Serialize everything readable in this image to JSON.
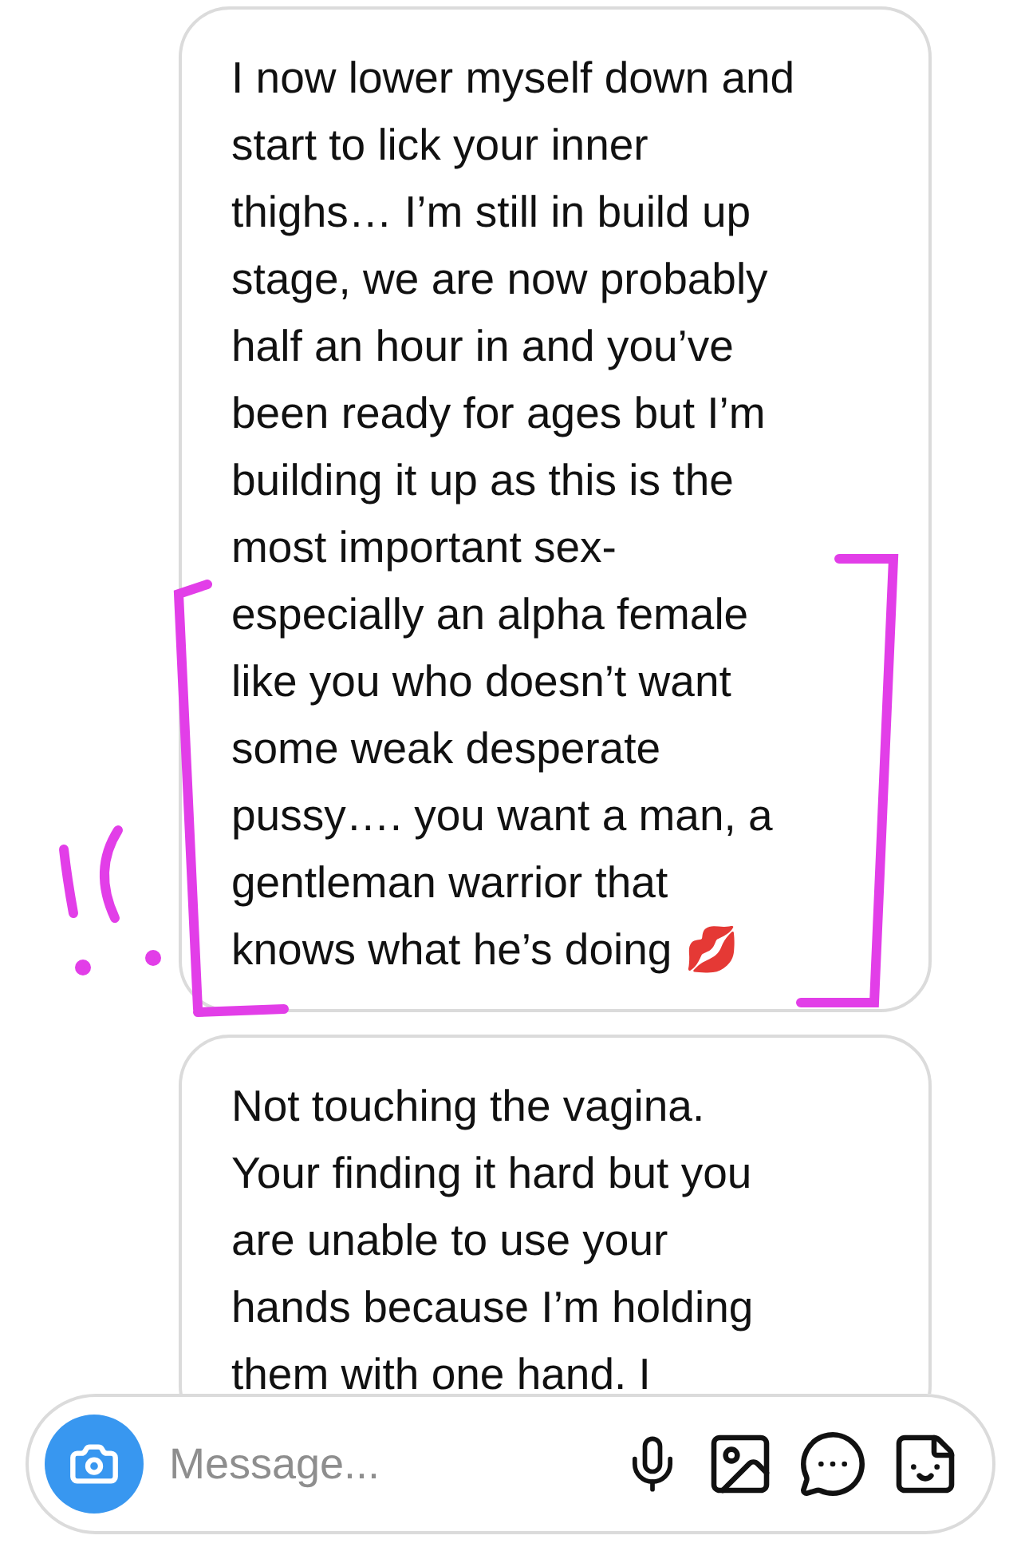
{
  "messages": [
    {
      "text": "I now lower myself down and start to lick your inner thighs… I’m still in build up stage, we are now probably half an hour in and you’ve been ready for ages but I’m building it up as this is the most important sex- especially an alpha female like you who doesn’t want some weak desperate pussy…. you want a man, a gentleman warrior that knows what he’s doing 💋"
    },
    {
      "text": "Not touching the vagina. Your finding it hard but you are unable to use your hands because I’m holding them with one hand. I"
    }
  ],
  "composer": {
    "placeholder": "Message..."
  }
}
